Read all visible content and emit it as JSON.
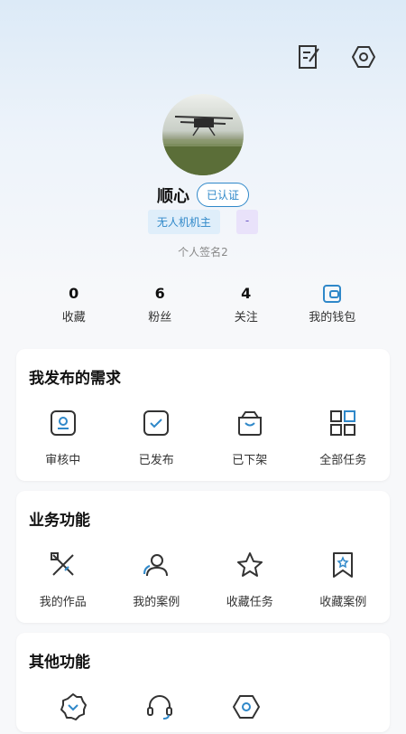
{
  "profile": {
    "name": "顺心",
    "verified_label": "已认证",
    "tags": [
      "无人机机主",
      "-"
    ],
    "signature": "个人签名2"
  },
  "stats": [
    {
      "value": "0",
      "label": "收藏"
    },
    {
      "value": "6",
      "label": "粉丝"
    },
    {
      "value": "4",
      "label": "关注"
    },
    {
      "label": "我的钱包",
      "icon": "wallet-icon"
    }
  ],
  "sections": [
    {
      "title": "我发布的需求",
      "items": [
        {
          "label": "审核中",
          "icon": "reviewing-icon"
        },
        {
          "label": "已发布",
          "icon": "published-icon"
        },
        {
          "label": "已下架",
          "icon": "bag-icon"
        },
        {
          "label": "全部任务",
          "icon": "grid-icon"
        }
      ]
    },
    {
      "title": "业务功能",
      "items": [
        {
          "label": "我的作品",
          "icon": "pencil-ruler-icon"
        },
        {
          "label": "我的案例",
          "icon": "users-icon"
        },
        {
          "label": "收藏任务",
          "icon": "star-icon"
        },
        {
          "label": "收藏案例",
          "icon": "bookmark-icon"
        }
      ]
    },
    {
      "title": "其他功能",
      "items": [
        {
          "label": "",
          "icon": "badge-check-icon"
        },
        {
          "label": "",
          "icon": "headset-icon"
        },
        {
          "label": "",
          "icon": "hexagon-settings-icon"
        }
      ]
    }
  ],
  "top_actions": [
    "edit-icon",
    "settings-icon"
  ],
  "colors": {
    "accent": "#2f88c9",
    "tag_purple": "#6a55c2"
  }
}
